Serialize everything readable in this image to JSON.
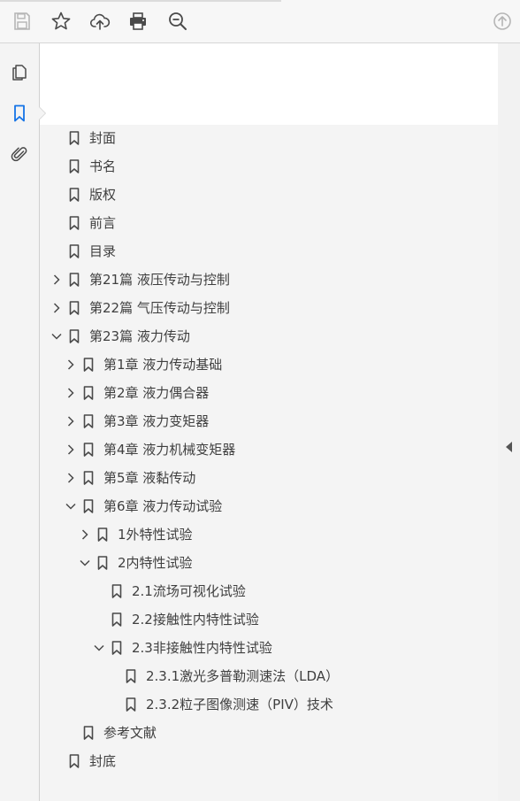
{
  "toolbar": {
    "buttons": [
      {
        "name": "save-icon"
      },
      {
        "name": "star-icon"
      },
      {
        "name": "upload-cloud-icon"
      },
      {
        "name": "print-icon"
      },
      {
        "name": "zoom-out-icon"
      },
      {
        "name": "scroll-up-icon"
      }
    ]
  },
  "sidebar": {
    "tools": [
      {
        "name": "pages-icon"
      },
      {
        "name": "bookmark-icon"
      },
      {
        "name": "attachment-icon"
      }
    ]
  },
  "bookmarks": [
    {
      "label": "封面",
      "level": 0,
      "expander": "none"
    },
    {
      "label": "书名",
      "level": 0,
      "expander": "none"
    },
    {
      "label": "版权",
      "level": 0,
      "expander": "none"
    },
    {
      "label": "前言",
      "level": 0,
      "expander": "none"
    },
    {
      "label": "目录",
      "level": 0,
      "expander": "none"
    },
    {
      "label": "第21篇  液压传动与控制",
      "level": 0,
      "expander": "collapsed"
    },
    {
      "label": "第22篇  气压传动与控制",
      "level": 0,
      "expander": "collapsed"
    },
    {
      "label": "第23篇  液力传动",
      "level": 0,
      "expander": "expanded"
    },
    {
      "label": "第1章  液力传动基础",
      "level": 1,
      "expander": "collapsed"
    },
    {
      "label": "第2章  液力偶合器",
      "level": 1,
      "expander": "collapsed"
    },
    {
      "label": "第3章  液力变矩器",
      "level": 1,
      "expander": "collapsed"
    },
    {
      "label": "第4章  液力机械变矩器",
      "level": 1,
      "expander": "collapsed"
    },
    {
      "label": "第5章  液黏传动",
      "level": 1,
      "expander": "collapsed"
    },
    {
      "label": "第6章  液力传动试验",
      "level": 1,
      "expander": "expanded"
    },
    {
      "label": "1外特性试验",
      "level": 2,
      "expander": "collapsed"
    },
    {
      "label": "2内特性试验",
      "level": 2,
      "expander": "expanded"
    },
    {
      "label": "2.1流场可视化试验",
      "level": 3,
      "expander": "none"
    },
    {
      "label": "2.2接触性内特性试验",
      "level": 3,
      "expander": "none"
    },
    {
      "label": "2.3非接触性内特性试验",
      "level": 3,
      "expander": "expanded"
    },
    {
      "label": "2.3.1激光多普勒测速法（LDA）",
      "level": 4,
      "expander": "none"
    },
    {
      "label": "2.3.2粒子图像测速（PIV）技术",
      "level": 4,
      "expander": "none"
    },
    {
      "label": "参考文献",
      "level": 1,
      "expander": "none"
    },
    {
      "label": "封底",
      "level": 0,
      "expander": "none"
    }
  ]
}
